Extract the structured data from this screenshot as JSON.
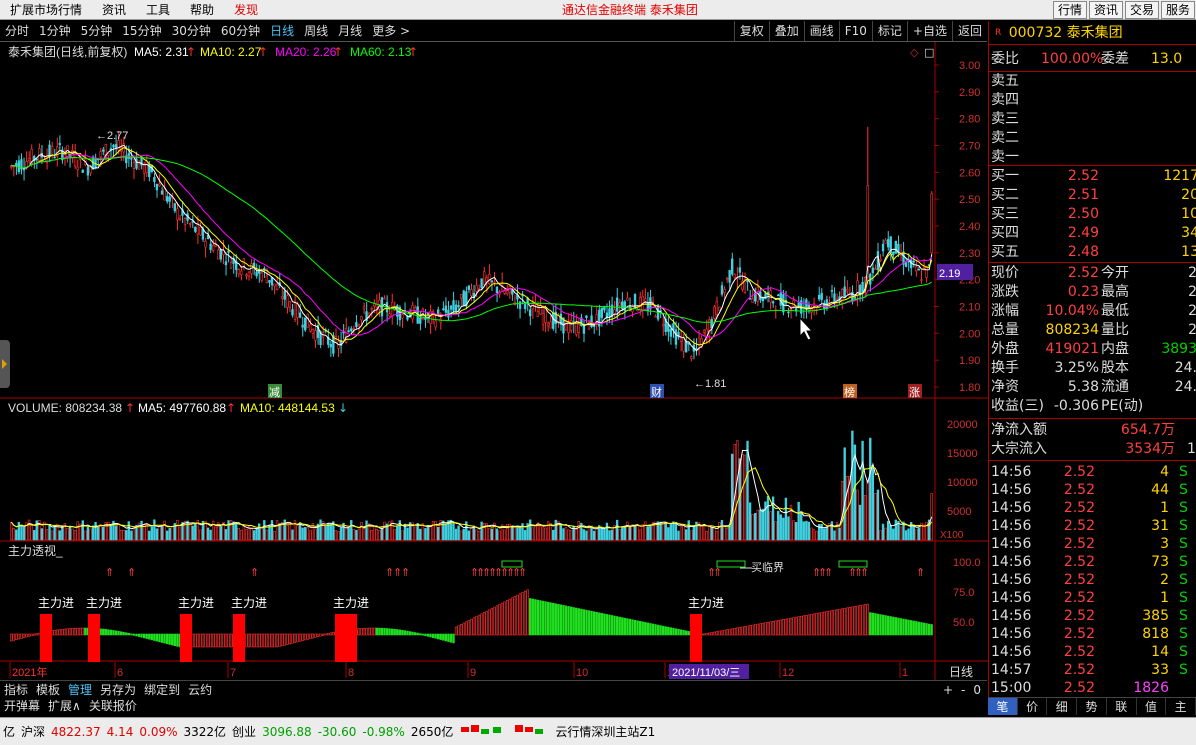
{
  "menubar": {
    "items": [
      "扩展市场行情",
      "资讯",
      "工具",
      "帮助",
      "发现"
    ],
    "center_title": "通达信金融终端  泰禾集团",
    "right_buttons": [
      "行情",
      "资讯",
      "交易",
      "服务"
    ]
  },
  "toolbar": {
    "periods": [
      "分时",
      "1分钟",
      "5分钟",
      "15分钟",
      "30分钟",
      "60分钟",
      "日线",
      "周线",
      "月线",
      "更多 >"
    ],
    "active_period": "日线",
    "right_tools": [
      "复权",
      "叠加",
      "画线",
      "F10",
      "标记",
      "+自选",
      "返回"
    ]
  },
  "stock": {
    "code": "000732",
    "name": "泰禾集团"
  },
  "chart": {
    "title_line": "泰禾集团(日线,前复权)",
    "ma_labels": [
      {
        "text": "MA5: 2.31",
        "color": "#ffffff"
      },
      {
        "text": "MA10: 2.27",
        "color": "#ffff00"
      },
      {
        "text": "MA20: 2.26",
        "color": "#ff00ff"
      },
      {
        "text": "MA60: 2.13",
        "color": "#00ff00"
      }
    ],
    "price_axis": [
      "3.00",
      "2.90",
      "2.80",
      "2.70",
      "2.60",
      "2.50",
      "2.40",
      "2.30",
      "2.20",
      "2.10",
      "2.00",
      "1.90",
      "1.80"
    ],
    "price_min": 1.8,
    "price_max": 3.0,
    "current_price_marker": "2.19",
    "high_annotation": "2.77",
    "low_annotation": "1.81",
    "event_tags": [
      "减",
      "财",
      "榜",
      "涨"
    ],
    "volume_label": "VOLUME: 808234.38",
    "vol_ma_labels": [
      {
        "text": "MA5: 497760.88",
        "color": "#ffffff"
      },
      {
        "text": "MA10: 448144.53",
        "color": "#ffff00"
      }
    ],
    "volume_axis": [
      "20000",
      "15000",
      "10000",
      "5000"
    ],
    "volume_unit": "X100",
    "indicator_name": "主力透视_",
    "indicator_axis": [
      "100.0",
      "75.0",
      "50.0"
    ],
    "indicator_labels": [
      "主力进",
      "主力进",
      "主力进",
      "主力进",
      "主力进",
      "主力进"
    ],
    "critical_label": "买临界",
    "x_axis_labels": [
      "2021年",
      "6",
      "7",
      "8",
      "9",
      "10",
      "11",
      "12",
      "1"
    ],
    "cursor_date": "2021/11/03/三",
    "axis_period": "日线"
  },
  "bottom_tabs": [
    "指标",
    "模板",
    "管理",
    "另存为",
    "绑定到",
    "云约"
  ],
  "bottom_tabs_active": "管理",
  "bottom_tabs2": [
    "开弹幕",
    "扩展∧",
    "关联报价"
  ],
  "zoom": [
    "+",
    "-",
    "0"
  ],
  "quote": {
    "weibi_label": "委比",
    "weibi": "100.00%",
    "weicha_label": "委差",
    "weicha": "13.0",
    "sell_labels": [
      "卖五",
      "卖四",
      "卖三",
      "卖二",
      "卖一"
    ],
    "buy": [
      {
        "label": "买一",
        "price": "2.52",
        "vol": "1217"
      },
      {
        "label": "买二",
        "price": "2.51",
        "vol": "20"
      },
      {
        "label": "买三",
        "price": "2.50",
        "vol": "10"
      },
      {
        "label": "买四",
        "price": "2.49",
        "vol": "34"
      },
      {
        "label": "买五",
        "price": "2.48",
        "vol": "13"
      }
    ],
    "stats": [
      {
        "l": "现价",
        "v": "2.52",
        "l2": "今开",
        "v2": "2"
      },
      {
        "l": "涨跌",
        "v": "0.23",
        "l2": "最高",
        "v2": "2"
      },
      {
        "l": "涨幅",
        "v": "10.04%",
        "l2": "最低",
        "v2": "2"
      },
      {
        "l": "总量",
        "v": "808234",
        "l2": "量比",
        "v2": "2"
      },
      {
        "l": "外盘",
        "v": "419021",
        "l2": "内盘",
        "v2": "3893"
      },
      {
        "l": "换手",
        "v": "3.25%",
        "l2": "股本",
        "v2": "24."
      },
      {
        "l": "净资",
        "v": "5.38",
        "l2": "流通",
        "v2": "24."
      },
      {
        "l": "收益(三)",
        "v": "-0.306",
        "l2": "PE(动)",
        "v2": ""
      }
    ],
    "flow": [
      {
        "l": "净流入额",
        "v": "654.7万"
      },
      {
        "l": "大宗流入",
        "v": "3534万",
        "extra": "1"
      }
    ],
    "ticks": [
      {
        "t": "14:56",
        "p": "2.52",
        "v": "4",
        "bs": "S"
      },
      {
        "t": "14:56",
        "p": "2.52",
        "v": "44",
        "bs": "S"
      },
      {
        "t": "14:56",
        "p": "2.52",
        "v": "1",
        "bs": "S"
      },
      {
        "t": "14:56",
        "p": "2.52",
        "v": "31",
        "bs": "S"
      },
      {
        "t": "14:56",
        "p": "2.52",
        "v": "3",
        "bs": "S"
      },
      {
        "t": "14:56",
        "p": "2.52",
        "v": "73",
        "bs": "S"
      },
      {
        "t": "14:56",
        "p": "2.52",
        "v": "2",
        "bs": "S"
      },
      {
        "t": "14:56",
        "p": "2.52",
        "v": "1",
        "bs": "S"
      },
      {
        "t": "14:56",
        "p": "2.52",
        "v": "385",
        "bs": "S"
      },
      {
        "t": "14:56",
        "p": "2.52",
        "v": "818",
        "bs": "S"
      },
      {
        "t": "14:56",
        "p": "2.52",
        "v": "14",
        "bs": "S"
      },
      {
        "t": "14:57",
        "p": "2.52",
        "v": "33",
        "bs": "S"
      },
      {
        "t": "15:00",
        "p": "2.52",
        "v": "1826",
        "bs": ""
      }
    ]
  },
  "right_tabs": [
    "笔",
    "价",
    "细",
    "势",
    "联",
    "值",
    "主"
  ],
  "statusbar": {
    "items": [
      {
        "t": "亿",
        "c": ""
      },
      {
        "t": "沪深",
        "c": ""
      },
      {
        "t": "4822.37",
        "c": "up"
      },
      {
        "t": "4.14",
        "c": "up"
      },
      {
        "t": "0.09%",
        "c": "up"
      },
      {
        "t": "3322亿",
        "c": ""
      },
      {
        "t": "创业",
        "c": ""
      },
      {
        "t": "3096.88",
        "c": "dn"
      },
      {
        "t": "-30.60",
        "c": "dn"
      },
      {
        "t": "-0.98%",
        "c": "dn"
      },
      {
        "t": "2650亿",
        "c": ""
      },
      {
        "t": "云行情深圳主站Z1",
        "c": ""
      }
    ]
  }
}
